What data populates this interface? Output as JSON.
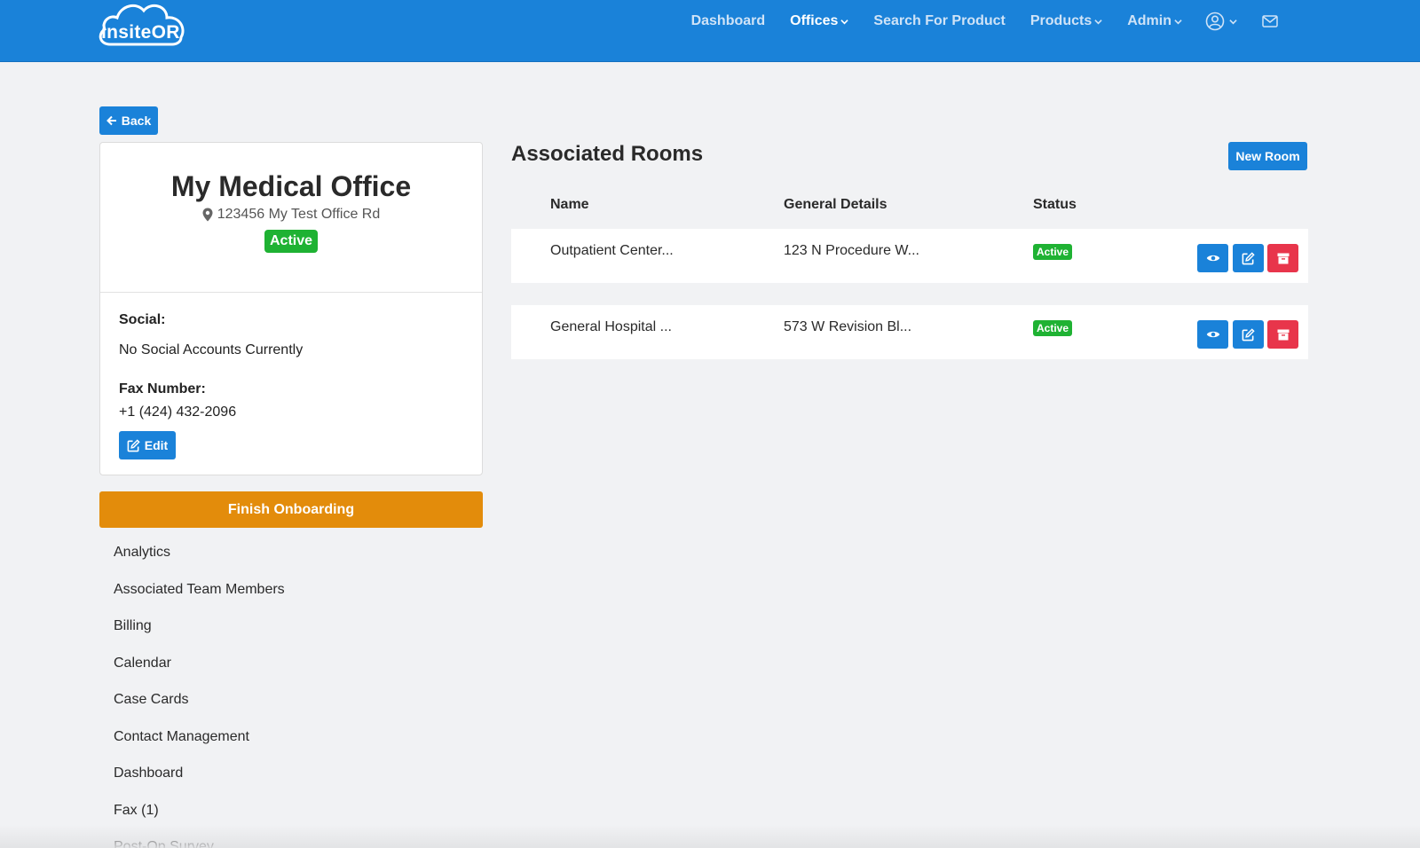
{
  "brand": {
    "logo_text": "insiteOR"
  },
  "nav": {
    "dashboard": "Dashboard",
    "offices": "Offices",
    "search": "Search For Product",
    "products": "Products",
    "admin": "Admin"
  },
  "back_label": "Back",
  "office": {
    "title": "My Medical Office",
    "address": "123456 My Test Office Rd",
    "status": "Active",
    "social_label": "Social:",
    "social_value": "No Social Accounts Currently",
    "fax_label": "Fax Number:",
    "fax_value": "+1 (424) 432-2096",
    "edit_label": "Edit"
  },
  "finish_onboarding": "Finish Onboarding",
  "menu": [
    "Analytics",
    "Associated Team Members",
    "Billing",
    "Calendar",
    "Case Cards",
    "Contact Management",
    "Dashboard",
    "Fax (1)",
    "Post-Op Survey"
  ],
  "rooms": {
    "title": "Associated Rooms",
    "new_room_label": "New Room",
    "columns": {
      "name": "Name",
      "details": "General Details",
      "status": "Status"
    },
    "rows": [
      {
        "name": "Outpatient Center...",
        "details": "123 N Procedure W...",
        "status": "Active"
      },
      {
        "name": "General Hospital ...",
        "details": "573 W Revision Bl...",
        "status": "Active"
      }
    ]
  },
  "colors": {
    "primary": "#1a82d9",
    "success": "#1fb233",
    "warning": "#e38c0b",
    "danger": "#e8354b"
  }
}
